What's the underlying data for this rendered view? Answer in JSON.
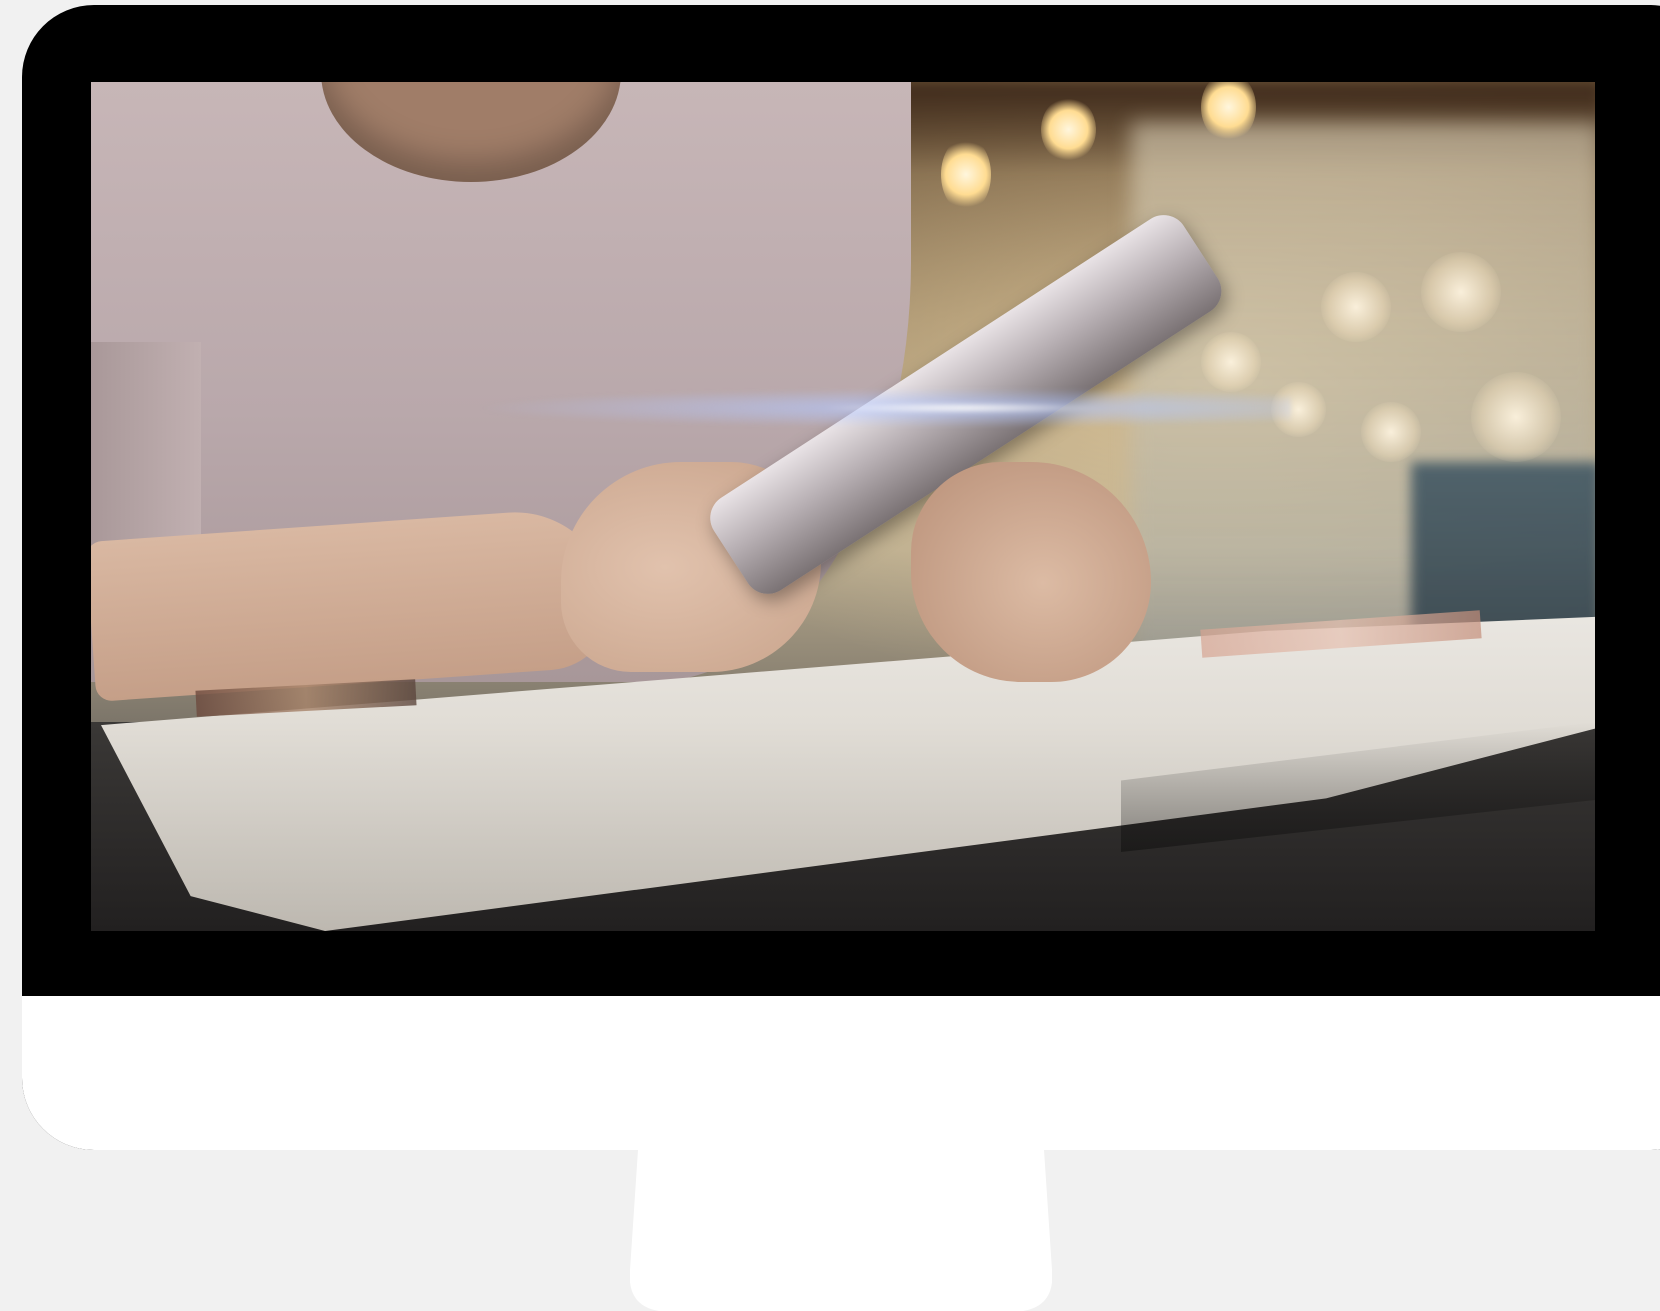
{
  "scene": {
    "subject": "",
    "colors": {
      "page_background": "#f1f1f1",
      "bezel": "#000000",
      "chin": "#ffffff",
      "stand": "#ffffff"
    }
  }
}
